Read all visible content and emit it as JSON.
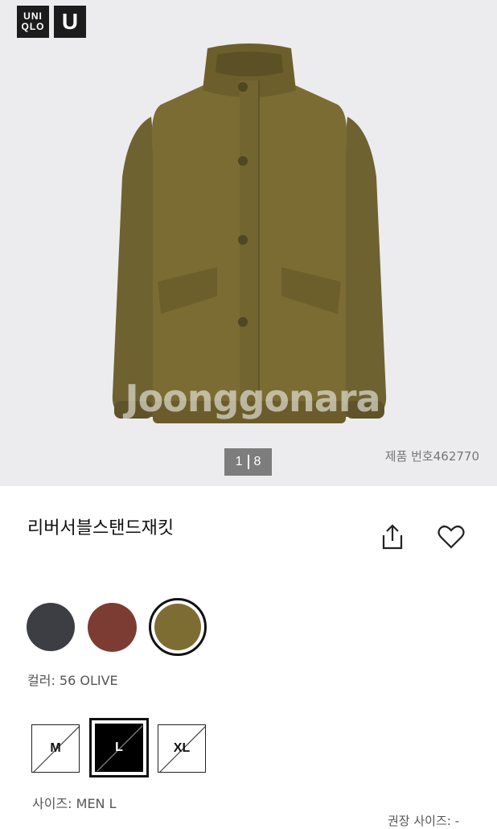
{
  "brand": {
    "logo_text_line1": "UNI",
    "logo_text_line2": "QLO",
    "logo_u": "U"
  },
  "gallery": {
    "pager_current": "1",
    "pager_total": "8",
    "watermark": "Joonggonara"
  },
  "product": {
    "number_label": "제품 번호462770",
    "title": "리버서블스탠드재킷"
  },
  "colors": {
    "swatches": [
      {
        "name": "dark-gray",
        "hex": "#3c3e44"
      },
      {
        "name": "red-brown",
        "hex": "#7d3c33"
      },
      {
        "name": "olive",
        "hex": "#7e6d32",
        "selected": true
      }
    ],
    "selected_label": "컬러: 56 OLIVE"
  },
  "sizes": {
    "options": [
      "M",
      "L",
      "XL"
    ],
    "selected": "L",
    "unavailable": [
      "M",
      "L",
      "XL"
    ],
    "selected_label": "사이즈: MEN L",
    "recommended_label": "권장 사이즈: -"
  },
  "icons": {
    "share": "share-icon",
    "favorite": "heart-icon"
  }
}
